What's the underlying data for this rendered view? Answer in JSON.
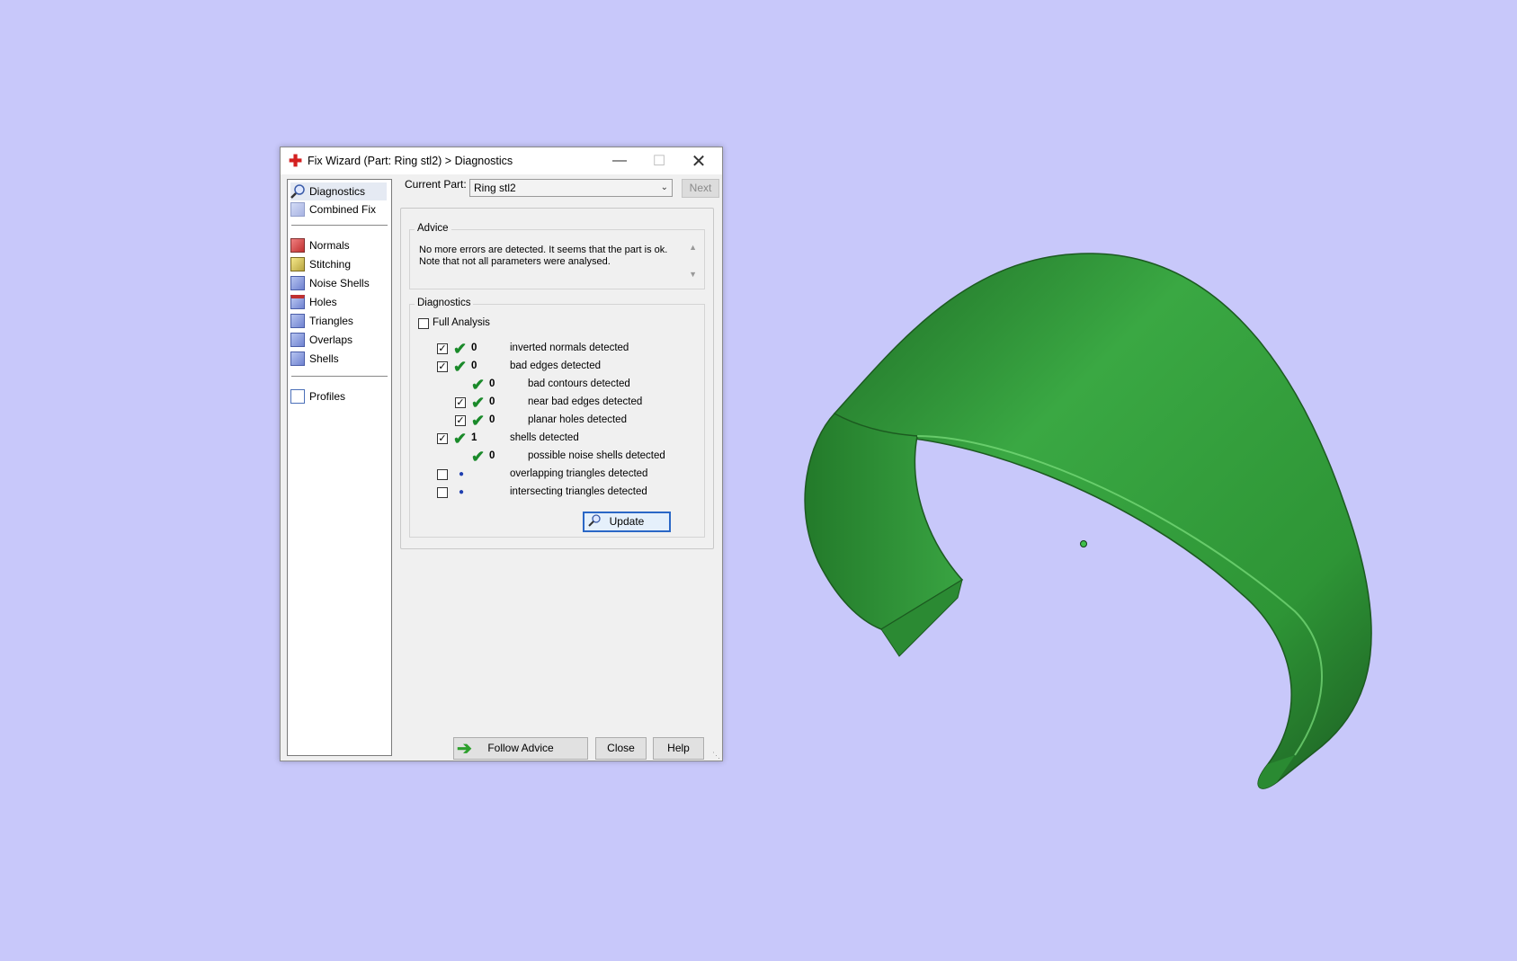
{
  "window": {
    "title": "Fix Wizard (Part: Ring stl2) > Diagnostics",
    "minimize": "—",
    "maximize": "☐",
    "close": "✕"
  },
  "sidebar": {
    "items": [
      {
        "label": "Diagnostics",
        "icon": "magnifier-icon"
      },
      {
        "label": "Combined Fix",
        "icon": "cube-icon"
      },
      {
        "label": "Normals",
        "icon": "cube-red-icon"
      },
      {
        "label": "Stitching",
        "icon": "cube-yellow-icon"
      },
      {
        "label": "Noise Shells",
        "icon": "noise-shells-icon"
      },
      {
        "label": "Holes",
        "icon": "cube-hole-icon"
      },
      {
        "label": "Triangles",
        "icon": "triangles-icon"
      },
      {
        "label": "Overlaps",
        "icon": "overlaps-icon"
      },
      {
        "label": "Shells",
        "icon": "shells-icon"
      },
      {
        "label": "Profiles",
        "icon": "document-icon"
      }
    ]
  },
  "current_part": {
    "label": "Current Part:",
    "value": "Ring stl2",
    "next": "Next"
  },
  "advice": {
    "title": "Advice",
    "line1": "No more errors are detected. It seems that the part is ok.",
    "line2": "Note that not all parameters were analysed."
  },
  "diagnostics": {
    "title": "Diagnostics",
    "full_analysis": "Full Analysis",
    "rows": [
      {
        "count": "0",
        "text": "inverted normals detected"
      },
      {
        "count": "0",
        "text": "bad edges detected"
      },
      {
        "count": "0",
        "text": "bad contours detected"
      },
      {
        "count": "0",
        "text": "near bad edges detected"
      },
      {
        "count": "0",
        "text": "planar holes detected"
      },
      {
        "count": "1",
        "text": "shells detected"
      },
      {
        "count": "0",
        "text": "possible noise shells detected"
      },
      {
        "count": "",
        "text": "overlapping triangles detected"
      },
      {
        "count": "",
        "text": "intersecting triangles detected"
      }
    ],
    "update": "Update"
  },
  "footer": {
    "follow_advice": "Follow Advice",
    "close": "Close",
    "help": "Help"
  },
  "colors": {
    "background": "#c8c8fa",
    "ring": "#34a03c",
    "check": "#1a8a2a"
  }
}
